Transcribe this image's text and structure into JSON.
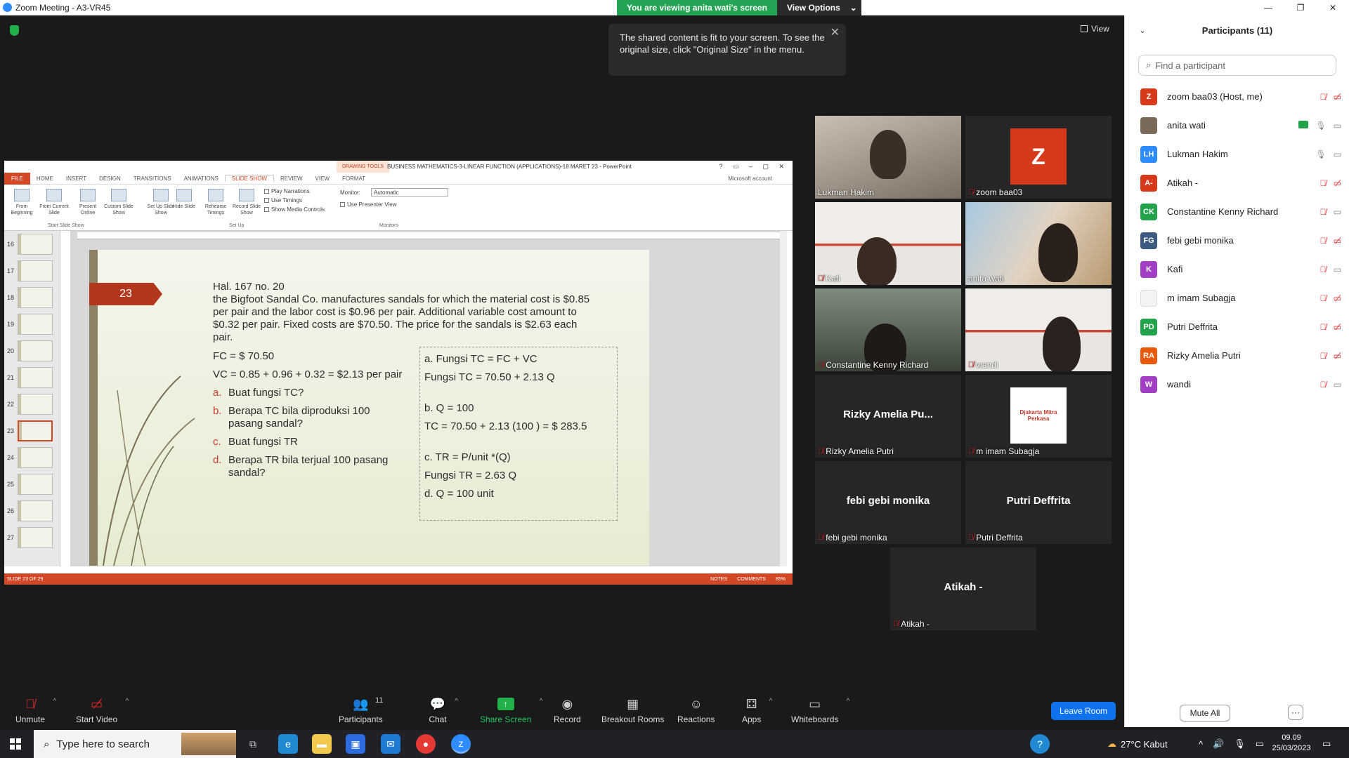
{
  "window": {
    "title": "Zoom Meeting - A3-VR45",
    "controls": [
      "—",
      "❐",
      "✕"
    ]
  },
  "banner": {
    "viewing": "You are viewing anita wati's screen",
    "view_options": "View Options"
  },
  "tooltip": {
    "text": "The shared content is fit to your screen. To see the original size, click \"Original Size\" in the menu."
  },
  "view_button": {
    "label": "View"
  },
  "powerpoint": {
    "drawing_tools": "DRAWING TOOLS",
    "title": "BUSINESS MATHEMATICS-3-LINEAR FUNCTION (APPLICATIONS)-18 MARET 23 - PowerPoint",
    "account": "Microsoft account",
    "tabs": [
      "FILE",
      "HOME",
      "INSERT",
      "DESIGN",
      "TRANSITIONS",
      "ANIMATIONS",
      "SLIDE SHOW",
      "REVIEW",
      "VIEW",
      "FORMAT"
    ],
    "ribbon_buttons": [
      {
        "label": "From Beginning"
      },
      {
        "label": "From Current Slide"
      },
      {
        "label": "Present Online"
      },
      {
        "label": "Custom Slide Show"
      },
      {
        "label": "Set Up Slide Show"
      },
      {
        "label": "Hide Slide"
      },
      {
        "label": "Rehearse Timings"
      },
      {
        "label": "Record Slide Show"
      }
    ],
    "checkboxes": [
      "Play Narrations",
      "Use Timings",
      "Show Media Controls"
    ],
    "monitor_label": "Monitor:",
    "monitor_value": "Automatic",
    "presenter_view": "Use Presenter View",
    "groups": [
      "Start Slide Show",
      "Set Up",
      "Monitors"
    ],
    "thumbnails": [
      "16",
      "17",
      "18",
      "19",
      "20",
      "21",
      "22",
      "23",
      "24",
      "25",
      "26",
      "27"
    ],
    "status_left": "SLIDE 23 OF 29",
    "status_notes": "NOTES",
    "status_comments": "COMMENTS",
    "zoom": "85%"
  },
  "slide": {
    "number": "23",
    "heading": "Hal. 167 no. 20",
    "problem": "the Bigfoot Sandal Co. manufactures sandals for which the material cost is $0.85 per pair and the labor cost is $0.96 per pair. Additional variable cost amount to $0.32 per pair. Fixed costs are $70.50. The price for the sandals is $2.63 each pair.",
    "fc": "FC = $ 70.50",
    "vc": "VC = 0.85 + 0.96 + 0.32 = $2.13 per pair",
    "questions": [
      {
        "letter": "a.",
        "text": "Buat fungsi TC?"
      },
      {
        "letter": "b.",
        "text": "Berapa TC bila diproduksi 100 pasang sandal?"
      },
      {
        "letter": "c.",
        "text": "Buat fungsi TR"
      },
      {
        "letter": "d.",
        "text": "Berapa TR bila terjual 100 pasang sandal?"
      }
    ],
    "answers": {
      "a1": "a. Fungsi TC = FC + VC",
      "a2": "Fungsi TC = 70.50 + 2.13 Q",
      "b1": "b. Q = 100",
      "b2": "TC = 70.50 + 2.13 (100 ) = $ 283.5",
      "c1": "c. TR = P/unit *(Q)",
      "c2": "Fungsi TR = 2.63 Q",
      "d1": "d. Q = 100 unit"
    }
  },
  "gallery": [
    {
      "name": "Lukman Hakim"
    },
    {
      "name": "zoom baa03",
      "initial": "Z"
    },
    {
      "name": "Kafi"
    },
    {
      "name": "anita wati"
    },
    {
      "name": "Constantine Kenny Richard"
    },
    {
      "name": "wandi"
    },
    {
      "name": "Rizky Amelia Putri",
      "big": "Rizky Amelia Pu..."
    },
    {
      "name": "m imam Subagja",
      "logo": "Djakarta Mitra Perkasa"
    },
    {
      "name": "febi gebi monika",
      "big": "febi gebi monika"
    },
    {
      "name": "Putri Deffrita",
      "big": "Putri Deffrita"
    },
    {
      "name": "Atikah -",
      "big": "Atikah -"
    }
  ],
  "participants": {
    "title": "Participants (11)",
    "search_placeholder": "Find a participant",
    "list": [
      {
        "initials": "Z",
        "name": "zoom baa03 (Host, me)",
        "color": "#d63a1b"
      },
      {
        "initials": "",
        "name": "anita wati",
        "color": "#7a6a5a"
      },
      {
        "initials": "LH",
        "name": "Lukman Hakim",
        "color": "#2d8cff"
      },
      {
        "initials": "A-",
        "name": "Atikah -",
        "color": "#d63a1b"
      },
      {
        "initials": "CK",
        "name": "Constantine Kenny Richard",
        "color": "#22a34a"
      },
      {
        "initials": "FG",
        "name": "febi gebi monika",
        "color": "#3d5a80"
      },
      {
        "initials": "K",
        "name": "Kafi",
        "color": "#a13ec4"
      },
      {
        "initials": "",
        "name": "m imam Subagja",
        "color": "#f4f4f4"
      },
      {
        "initials": "PD",
        "name": "Putri Deffrita",
        "color": "#22a34a"
      },
      {
        "initials": "RA",
        "name": "Rizky Amelia Putri",
        "color": "#e8590c"
      },
      {
        "initials": "W",
        "name": "wandi",
        "color": "#a13ec4"
      }
    ],
    "mute_all": "Mute All",
    "more": "···"
  },
  "toolbar": {
    "unmute": "Unmute",
    "start_video": "Start Video",
    "participants": "Participants",
    "participants_count": "11",
    "chat": "Chat",
    "share_screen": "Share Screen",
    "record": "Record",
    "breakout": "Breakout Rooms",
    "reactions": "Reactions",
    "apps": "Apps",
    "whiteboards": "Whiteboards",
    "leave": "Leave Room"
  },
  "taskbar": {
    "search_placeholder": "Type here to search",
    "weather": "27°C  Kabut",
    "time": "09.09",
    "date": "25/03/2023"
  }
}
